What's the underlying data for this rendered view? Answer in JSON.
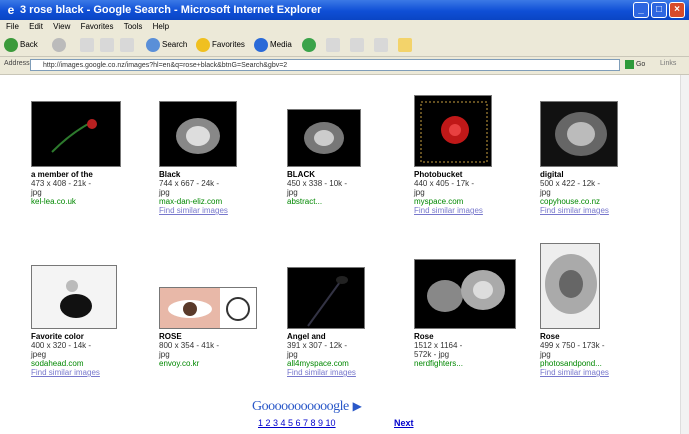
{
  "window": {
    "title": "3 rose black - Google Search - Microsoft Internet Explorer"
  },
  "menu": [
    "File",
    "Edit",
    "View",
    "Favorites",
    "Tools",
    "Help"
  ],
  "toolbar": {
    "back": "Back",
    "search": "Search",
    "favorites": "Favorites",
    "media": "Media"
  },
  "address": {
    "label": "Address",
    "url": "http://images.google.co.nz/images?hl=en&q=rose+black&btnG=Search&gbv=2",
    "go": "Go",
    "links": "Links"
  },
  "results": [
    {
      "label": "a member of the",
      "meta": "473 x 408 - 21k -\njpg",
      "site": "kel-lea.co.uk",
      "similar": ""
    },
    {
      "label": "Black",
      "meta": "744 x 667 - 24k -\njpg",
      "site": "max-dan-eliz.com",
      "similar": "Find similar images"
    },
    {
      "label": "BLACK",
      "meta": "450 x 338 - 10k -\njpg",
      "site": "abstract...",
      "similar": ""
    },
    {
      "label": "Photobucket",
      "meta": "440 x 405 - 17k -\njpg",
      "site": "myspace.com",
      "similar": "Find similar images"
    },
    {
      "label": "digital",
      "meta": "500 x 422 - 12k -\njpg",
      "site": "copyhouse.co.nz",
      "similar": "Find similar images"
    },
    {
      "label": "Favorite color",
      "meta": "400 x 320 - 14k -\njpeg",
      "site": "sodahead.com",
      "similar": "Find similar images"
    },
    {
      "label": "ROSE",
      "meta": "800 x 354 - 41k -\njpg",
      "site": "envoy.co.kr",
      "similar": ""
    },
    {
      "label": "Angel and",
      "meta": "391 x 307 - 12k -\njpg",
      "site": "all4myspace.com",
      "similar": "Find similar images"
    },
    {
      "label": "Rose",
      "meta": "1512 x 1164 -\n572k - jpg",
      "site": "nerdfighters...",
      "similar": ""
    },
    {
      "label": "Rose",
      "meta": "499 x 750 - 173k -\njpg",
      "site": "photosandpond...",
      "similar": "Find similar images"
    }
  ],
  "pager": {
    "logo": "Gooooooooooogle",
    "pages": "1 2 3 4 5 6 7 8 9 10",
    "next": "Next"
  }
}
